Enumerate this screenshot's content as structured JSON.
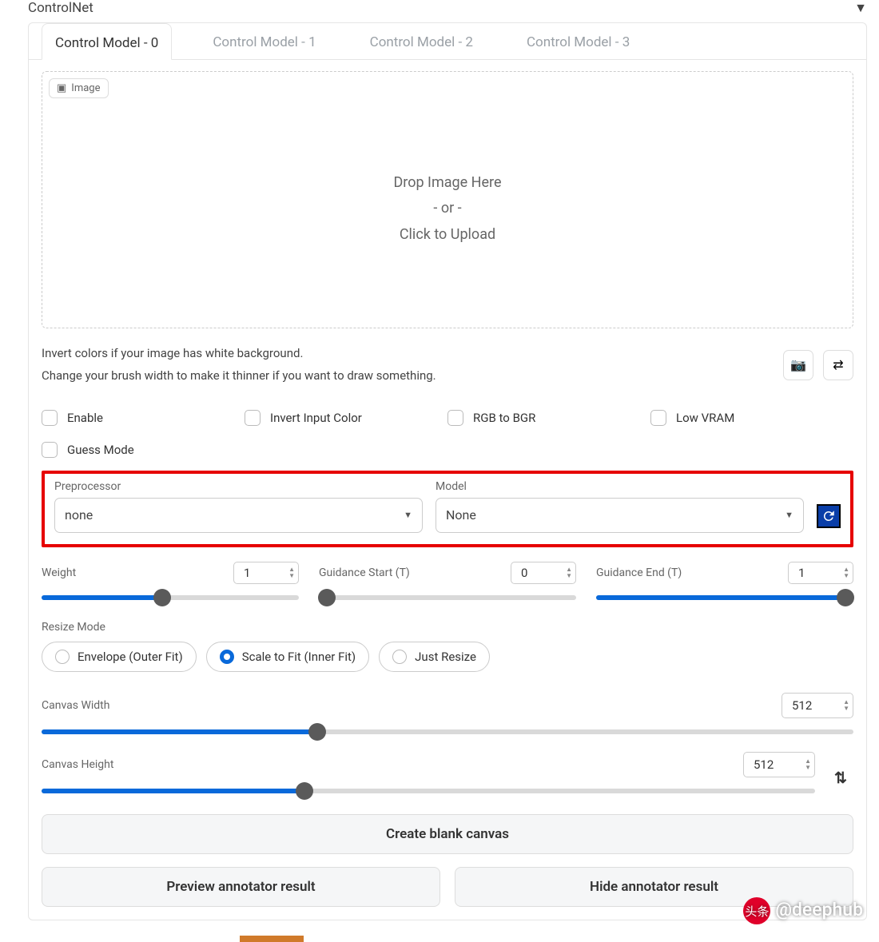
{
  "title": "ControlNet",
  "tabs": [
    "Control Model - 0",
    "Control Model - 1",
    "Control Model - 2",
    "Control Model - 3"
  ],
  "img_tag": "Image",
  "drop": {
    "l1": "Drop Image Here",
    "l2": "- or -",
    "l3": "Click to Upload"
  },
  "hint1": "Invert colors if your image has white background.",
  "hint2": "Change your brush width to make it thinner if you want to draw something.",
  "checks": [
    "Enable",
    "Invert Input Color",
    "RGB to BGR",
    "Low VRAM",
    "Guess Mode"
  ],
  "preproc": {
    "label": "Preprocessor",
    "value": "none"
  },
  "model": {
    "label": "Model",
    "value": "None"
  },
  "weight": {
    "label": "Weight",
    "value": "1"
  },
  "gstart": {
    "label": "Guidance Start (T)",
    "value": "0"
  },
  "gend": {
    "label": "Guidance End (T)",
    "value": "1"
  },
  "resize": {
    "label": "Resize Mode",
    "opts": [
      "Envelope (Outer Fit)",
      "Scale to Fit (Inner Fit)",
      "Just Resize"
    ]
  },
  "cw": {
    "label": "Canvas Width",
    "value": "512"
  },
  "ch": {
    "label": "Canvas Height",
    "value": "512"
  },
  "btns": {
    "blank": "Create blank canvas",
    "preview": "Preview annotator result",
    "hide": "Hide annotator result"
  },
  "wm": "@deephub",
  "wmpre": "头条"
}
